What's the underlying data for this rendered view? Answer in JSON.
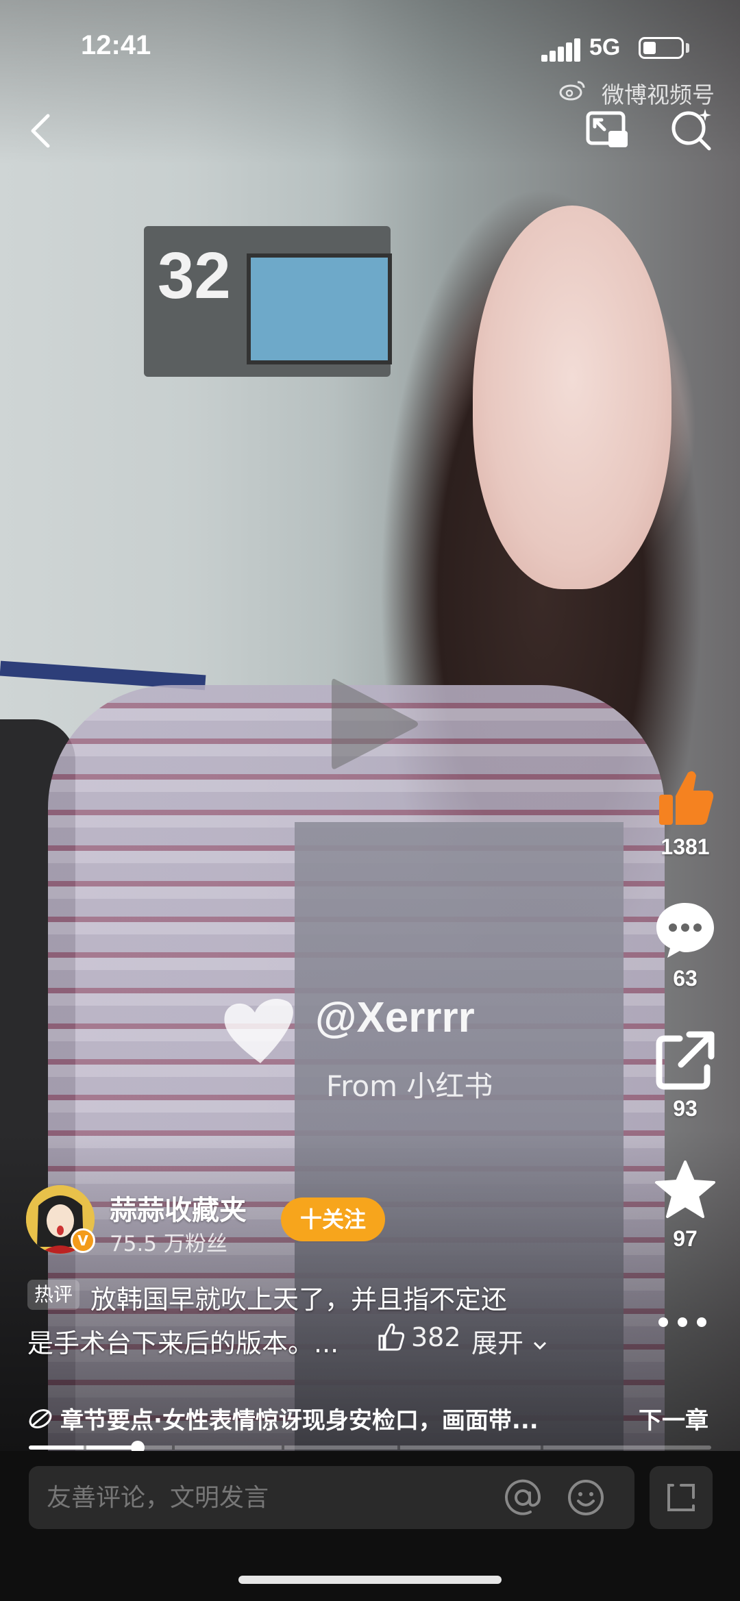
{
  "status_bar": {
    "time": "12:41",
    "network": "5G",
    "battery_level": 0.35
  },
  "watermark": {
    "brand": "微博视频号"
  },
  "video_overlay": {
    "gate_number": "32",
    "handle": "@Xerrrr",
    "source": "From 小红书"
  },
  "actions": {
    "like_count": "1381",
    "comment_count": "63",
    "share_count": "93",
    "favorite_count": "97"
  },
  "author": {
    "name": "蒜蒜收藏夹",
    "fans": "75.5 万粉丝",
    "follow_label": "十关注",
    "verified_mark": "V"
  },
  "hot_comment": {
    "badge": "热评",
    "line1": "放韩国早就吹上天了，并且指不定还",
    "line2": "是手术台下来后的版本。...",
    "likes": "382",
    "expand_label": "展开"
  },
  "chapter": {
    "text": "章节要点·女性表情惊讶现身安检口，画面带...",
    "next_label": "下一章"
  },
  "progress": {
    "played_fraction": 0.16,
    "chapter_marks": [
      0.08,
      0.21,
      0.37,
      0.54,
      0.75
    ]
  },
  "comment_bar": {
    "placeholder": "友善评论，文明发言"
  },
  "colors": {
    "accent_orange": "#f7a51c",
    "like_orange": "#f58220"
  },
  "icons": [
    "back-icon",
    "pip-icon",
    "search-icon",
    "play-icon",
    "like-icon",
    "comment-icon",
    "share-icon",
    "star-icon",
    "more-icon",
    "at-icon",
    "emoji-icon",
    "rotate-icon"
  ]
}
